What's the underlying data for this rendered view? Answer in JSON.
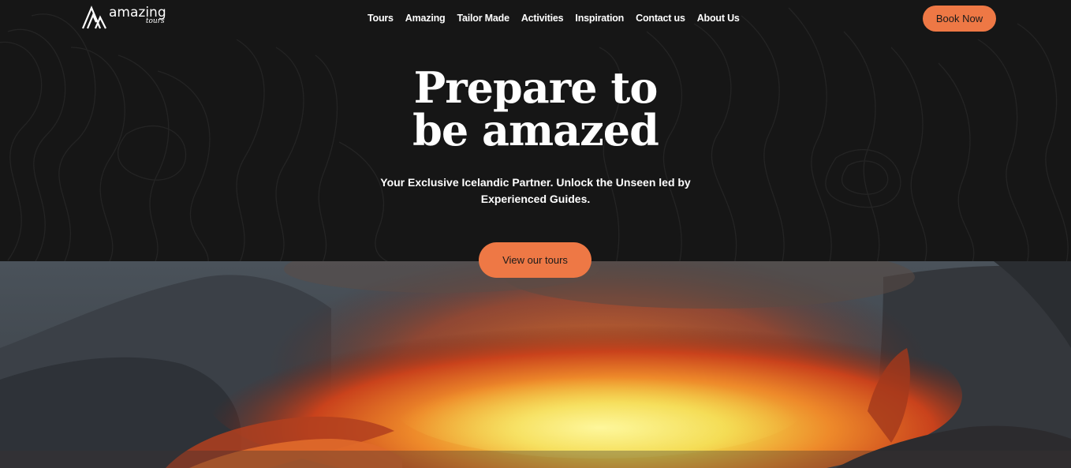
{
  "header": {
    "logo": {
      "word": "amazing",
      "sub": "tours"
    },
    "nav": [
      {
        "label": "Tours"
      },
      {
        "label": "Amazing"
      },
      {
        "label": "Tailor Made"
      },
      {
        "label": "Activities"
      },
      {
        "label": "Inspiration"
      },
      {
        "label": "Contact us"
      },
      {
        "label": "About Us"
      }
    ],
    "book_label": "Book Now"
  },
  "hero": {
    "title_line1": "Prepare to",
    "title_line2": "be amazed",
    "subtitle_line1": "Your Exclusive Icelandic Partner. Unlock the Unseen led by",
    "subtitle_line2": "Experienced Guides.",
    "cta_label": "View our tours"
  },
  "colors": {
    "background": "#161616",
    "accent": "#ee7845",
    "text": "#ffffff"
  }
}
